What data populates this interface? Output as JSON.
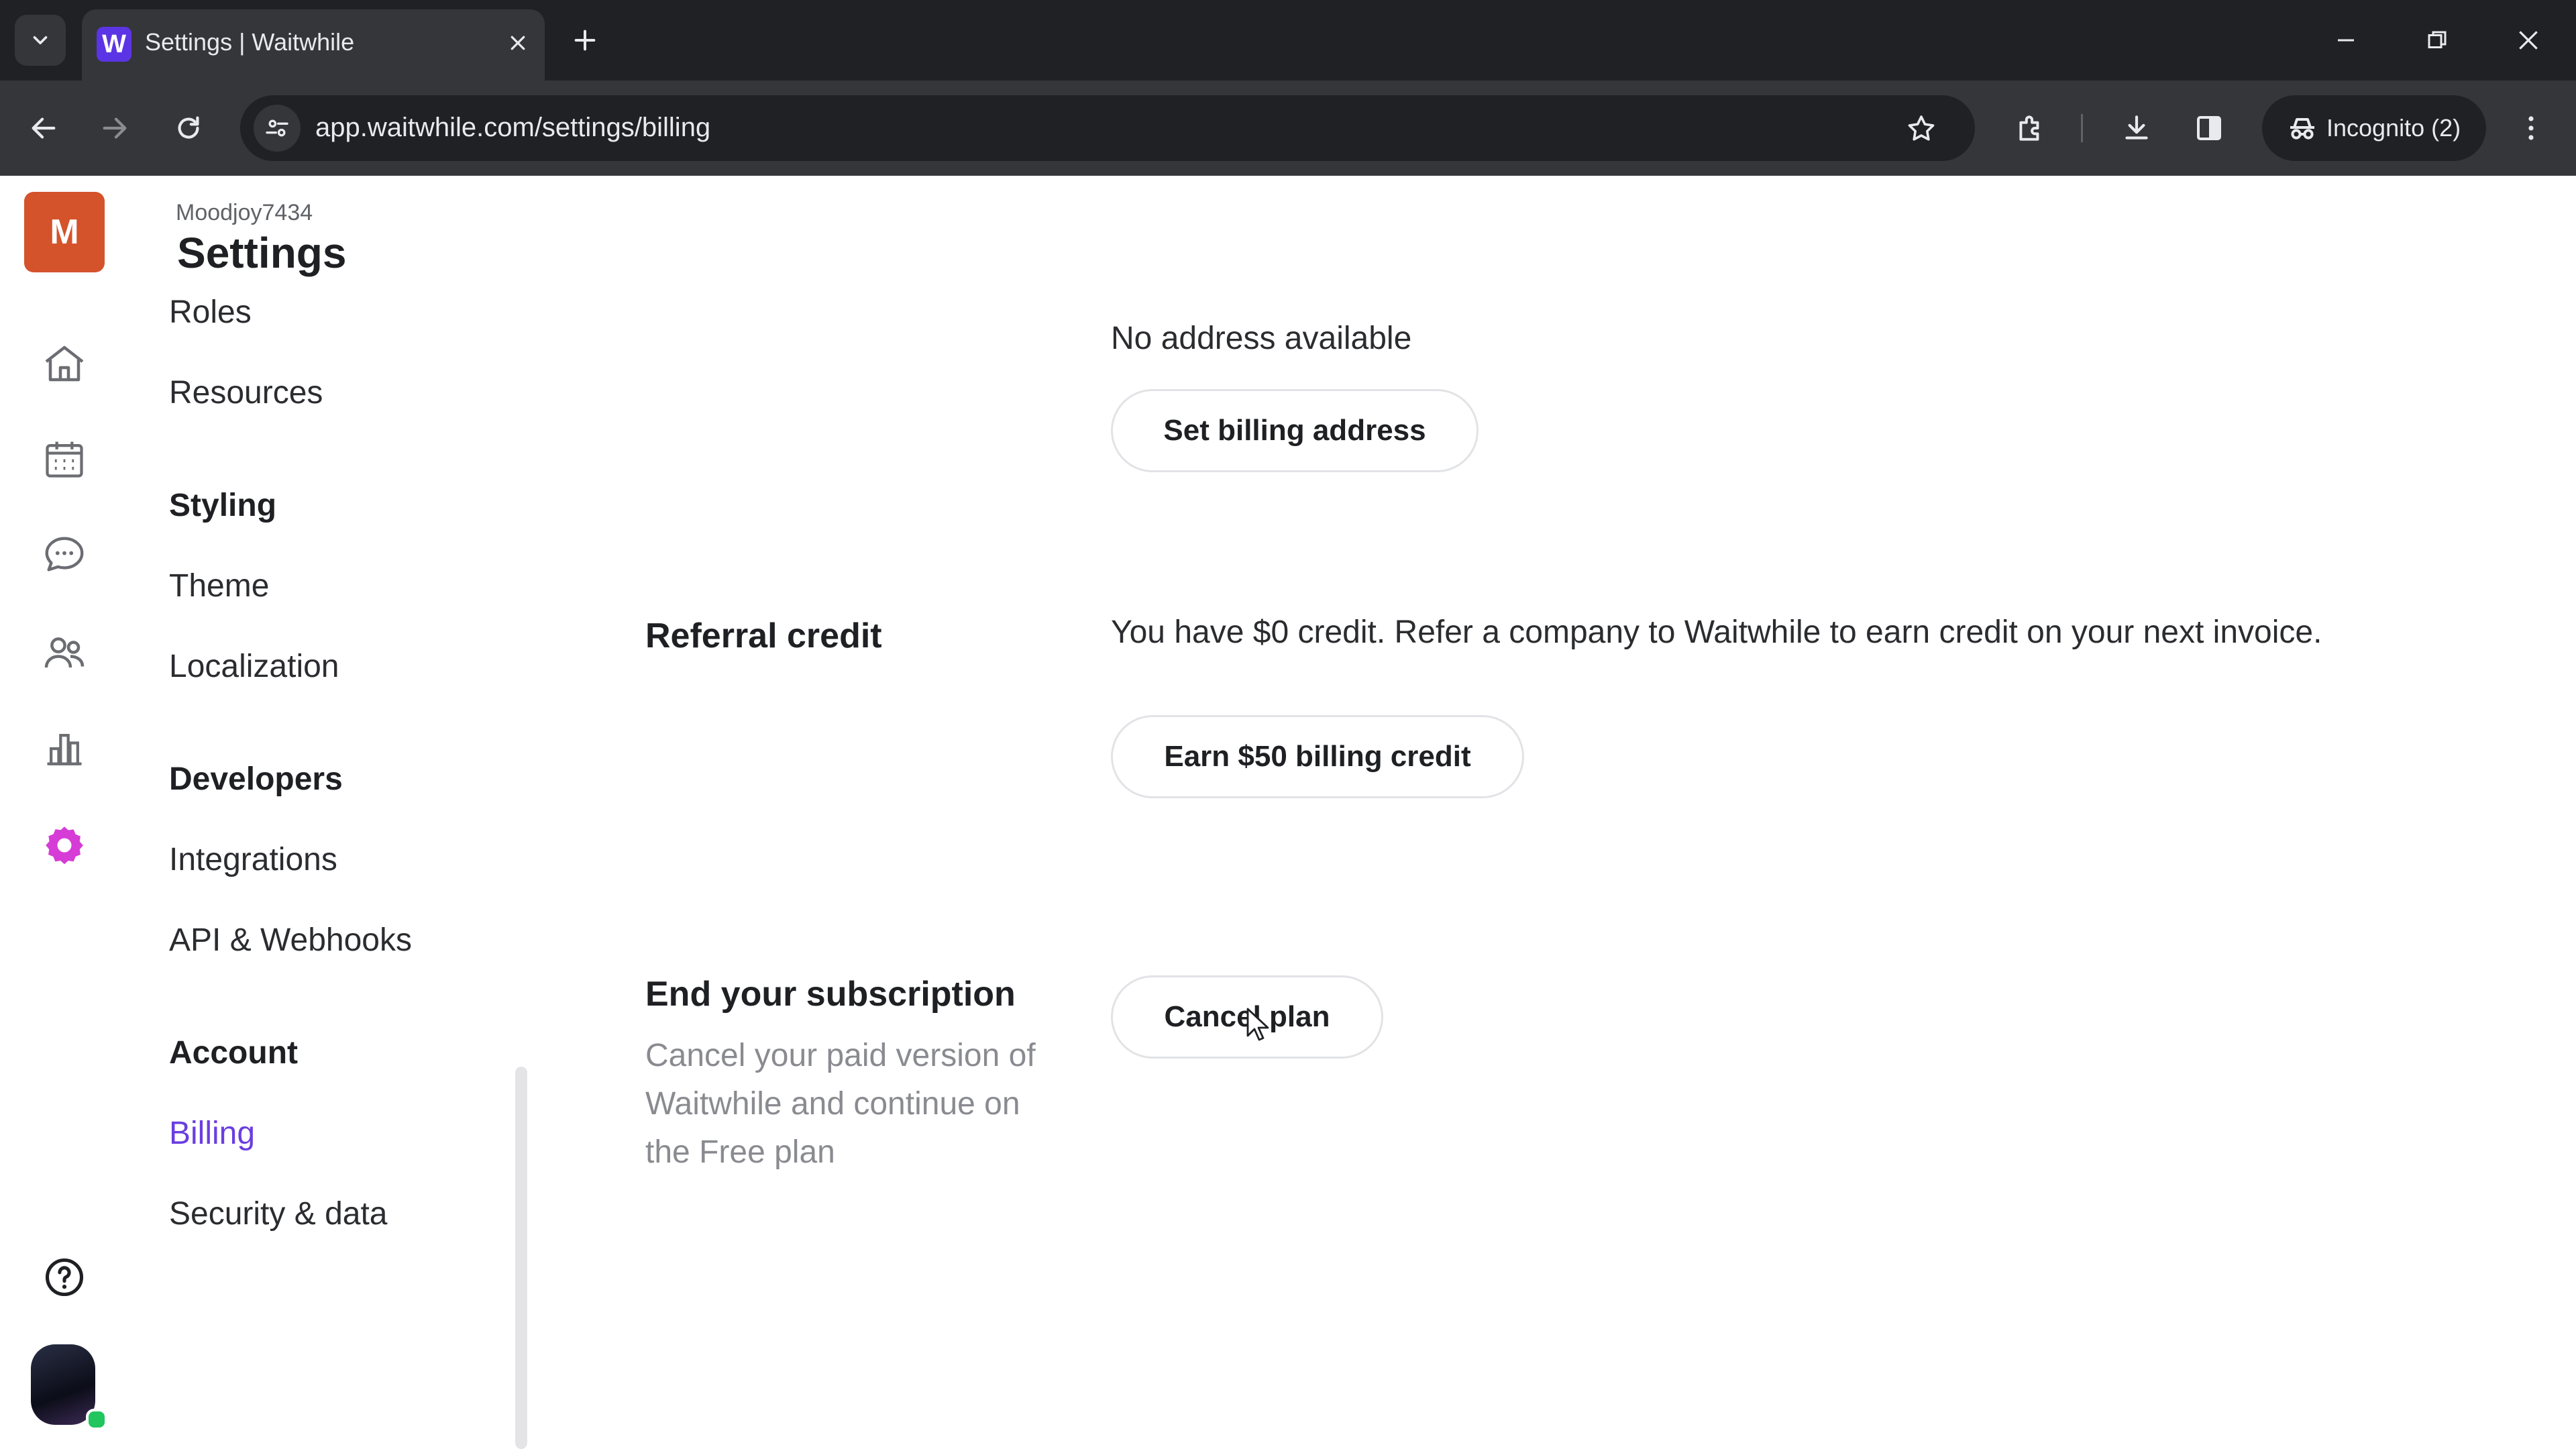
{
  "browser": {
    "tab_title": "Settings | Waitwhile",
    "favicon_letter": "W",
    "url": "app.waitwhile.com/settings/billing",
    "incognito_label": "Incognito (2)"
  },
  "rail": {
    "org_initial": "M",
    "icons": [
      "home-icon",
      "calendar-icon",
      "chat-icon",
      "customers-icon",
      "analytics-icon",
      "settings-icon",
      "help-icon"
    ],
    "active_color": "#d63cd6"
  },
  "settings": {
    "org_name": "Moodjoy7434",
    "title": "Settings",
    "nav": {
      "roles": "Roles",
      "resources": "Resources",
      "styling": "Styling",
      "theme": "Theme",
      "localization": "Localization",
      "developers": "Developers",
      "integrations": "Integrations",
      "api_webhooks": "API & Webhooks",
      "account": "Account",
      "billing": "Billing",
      "security_data": "Security & data"
    }
  },
  "main": {
    "no_address": "No address available",
    "set_billing_address": "Set billing address",
    "referral_label": "Referral credit",
    "referral_text": "You have $0 credit. Refer a company to Waitwhile to earn credit on your next invoice.",
    "earn_credit": "Earn $50 billing credit",
    "end_subscription_label": "End your subscription",
    "end_subscription_desc": "Cancel your paid version of Waitwhile and continue on the Free plan",
    "cancel_plan": "Cancel plan"
  },
  "colors": {
    "accent": "#6a3ee0",
    "org_avatar": "#d4532b",
    "chrome_dark": "#202124",
    "chrome_toolbar": "#35363a"
  }
}
